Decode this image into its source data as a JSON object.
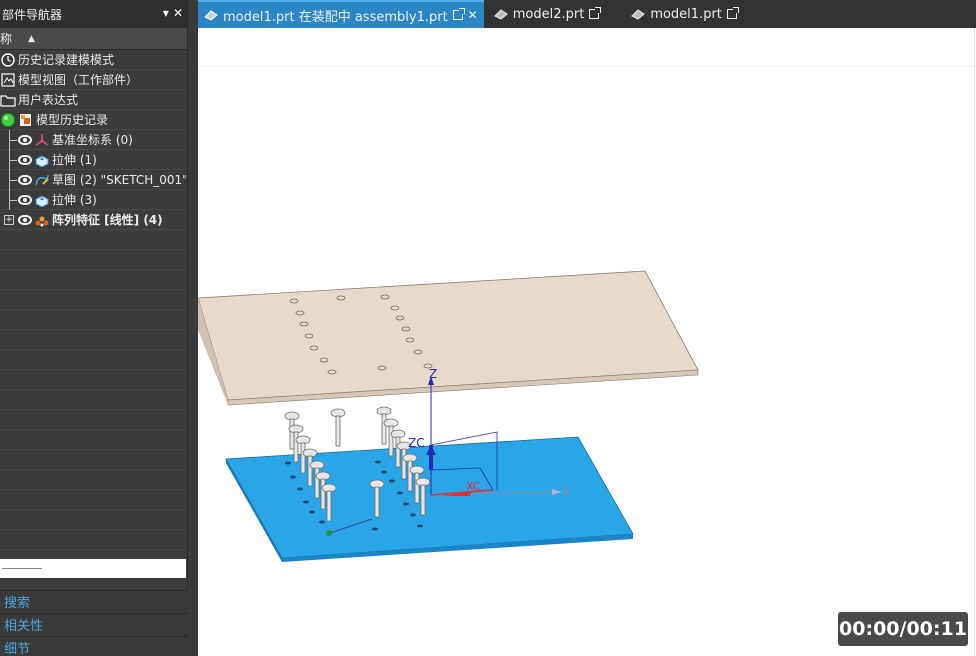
{
  "navigator": {
    "title": "部件导航器",
    "dropdown_icon": "chevron-down-icon",
    "close_icon": "close-icon",
    "column_name": "称",
    "rows": [
      {
        "label": "历史记录建模模式",
        "icon": "clock-icon"
      },
      {
        "label": "模型视图（工作部件）",
        "icon": "model-view-icon"
      },
      {
        "label": "用户表达式",
        "icon": "folder-icon"
      },
      {
        "label": "模型历史记录",
        "icon": "history-icon"
      },
      {
        "label": "基准坐标系 (0)",
        "icon": "datum-csys-icon"
      },
      {
        "label": "拉伸 (1)",
        "icon": "extrude-icon"
      },
      {
        "label": "草图 (2) \"SKETCH_001\"",
        "icon": "sketch-icon"
      },
      {
        "label": "拉伸 (3)",
        "icon": "extrude-icon"
      },
      {
        "label": "阵列特征 [线性] (4)",
        "icon": "pattern-icon"
      }
    ],
    "sections": [
      "搜索",
      "相关性",
      "细节"
    ]
  },
  "tabs": [
    {
      "label": "model1.prt 在装配中 assembly1.prt",
      "active": true
    },
    {
      "label": "model2.prt",
      "active": false
    },
    {
      "label": "model1.prt",
      "active": false
    }
  ],
  "viewport": {
    "axis_labels": {
      "z": "Z",
      "zc": "ZC",
      "xc": "XC",
      "x": "X"
    },
    "colors": {
      "plate_top": "#e6d8c9",
      "plate_bottom": "#29a8e8",
      "axis": "#2a2ab8",
      "xc": "#e03030"
    }
  },
  "timer": "00:00/00:11"
}
